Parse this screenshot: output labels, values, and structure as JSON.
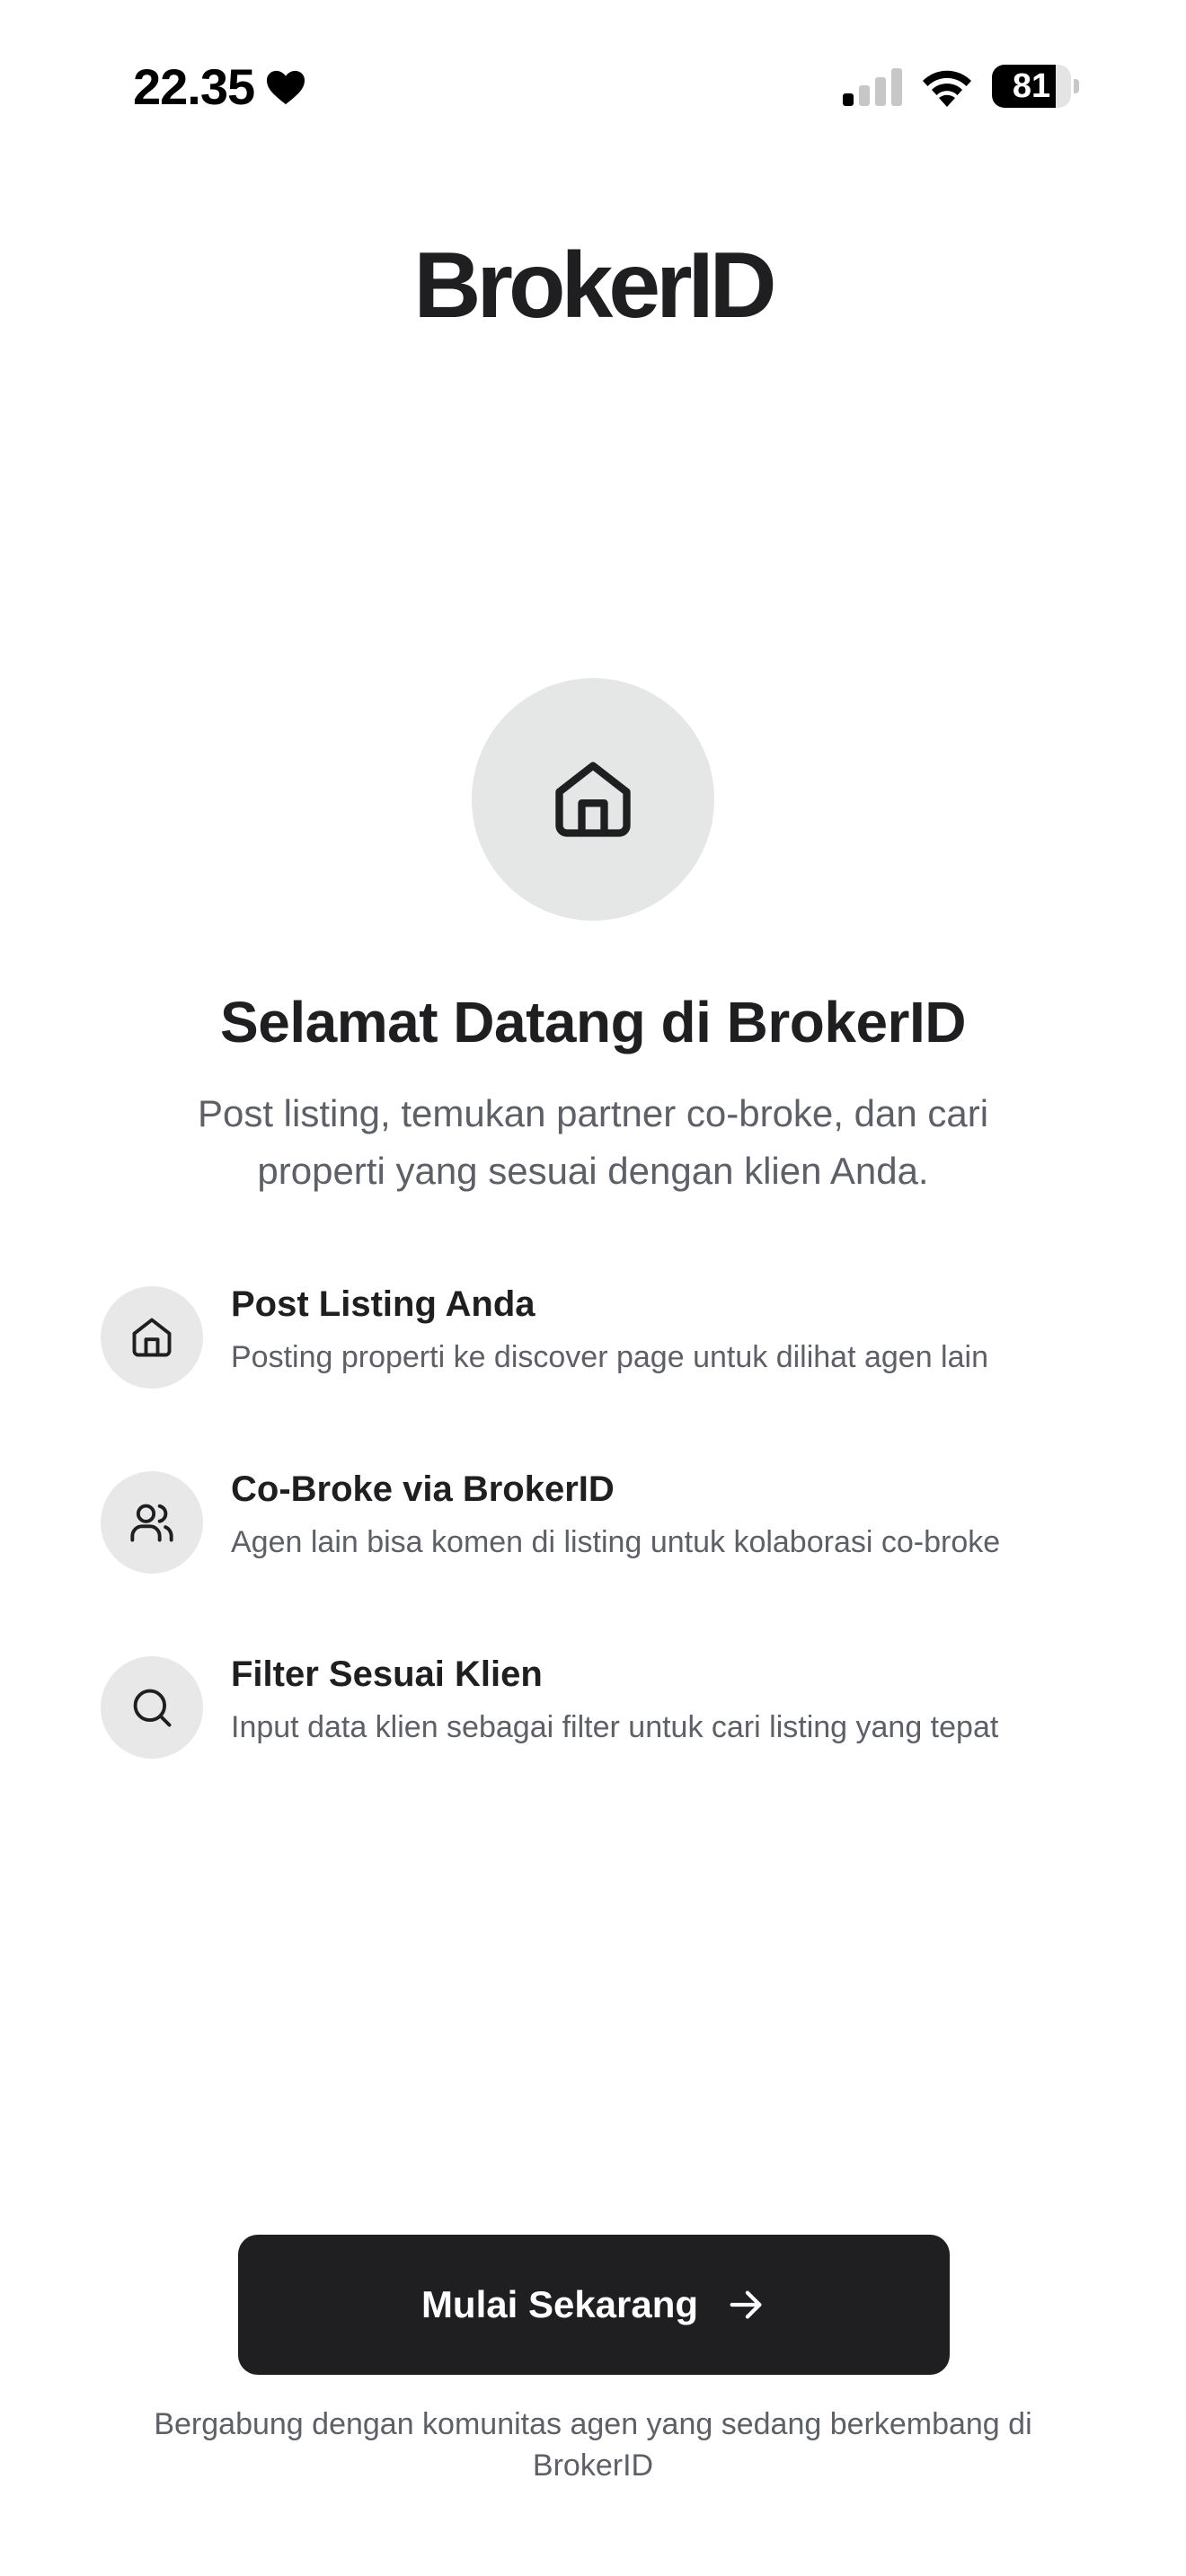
{
  "status_bar": {
    "time": "22.35",
    "heart_icon": "heart-icon",
    "signal_icon": "cellular-signal-icon",
    "signal_bars_active": 1,
    "signal_bars_total": 4,
    "wifi_icon": "wifi-icon",
    "battery_level": "81",
    "battery_fraction": 0.81
  },
  "brand": {
    "name": "BrokerID"
  },
  "hero": {
    "icon": "house-icon",
    "title": "Selamat Datang di BrokerID",
    "subtitle": "Post listing, temukan partner co-broke, dan cari properti yang sesuai dengan klien Anda."
  },
  "features": [
    {
      "icon": "house-icon",
      "title": "Post Listing Anda",
      "description": "Posting properti ke discover page untuk dilihat agen lain"
    },
    {
      "icon": "users-icon",
      "title": "Co-Broke via BrokerID",
      "description": "Agen lain bisa komen di listing untuk kolaborasi co-broke"
    },
    {
      "icon": "search-icon",
      "title": "Filter Sesuai Klien",
      "description": "Input data klien sebagai filter untuk cari listing yang tepat"
    }
  ],
  "cta": {
    "label": "Mulai Sekarang",
    "icon": "arrow-right-icon"
  },
  "footer": {
    "note": "Bergabung dengan komunitas agen yang sedang berkembang di BrokerID"
  },
  "colors": {
    "primary": "#1f1f21",
    "muted_text": "#5d6066",
    "icon_bg": "#e5e6e6",
    "background": "#ffffff"
  }
}
